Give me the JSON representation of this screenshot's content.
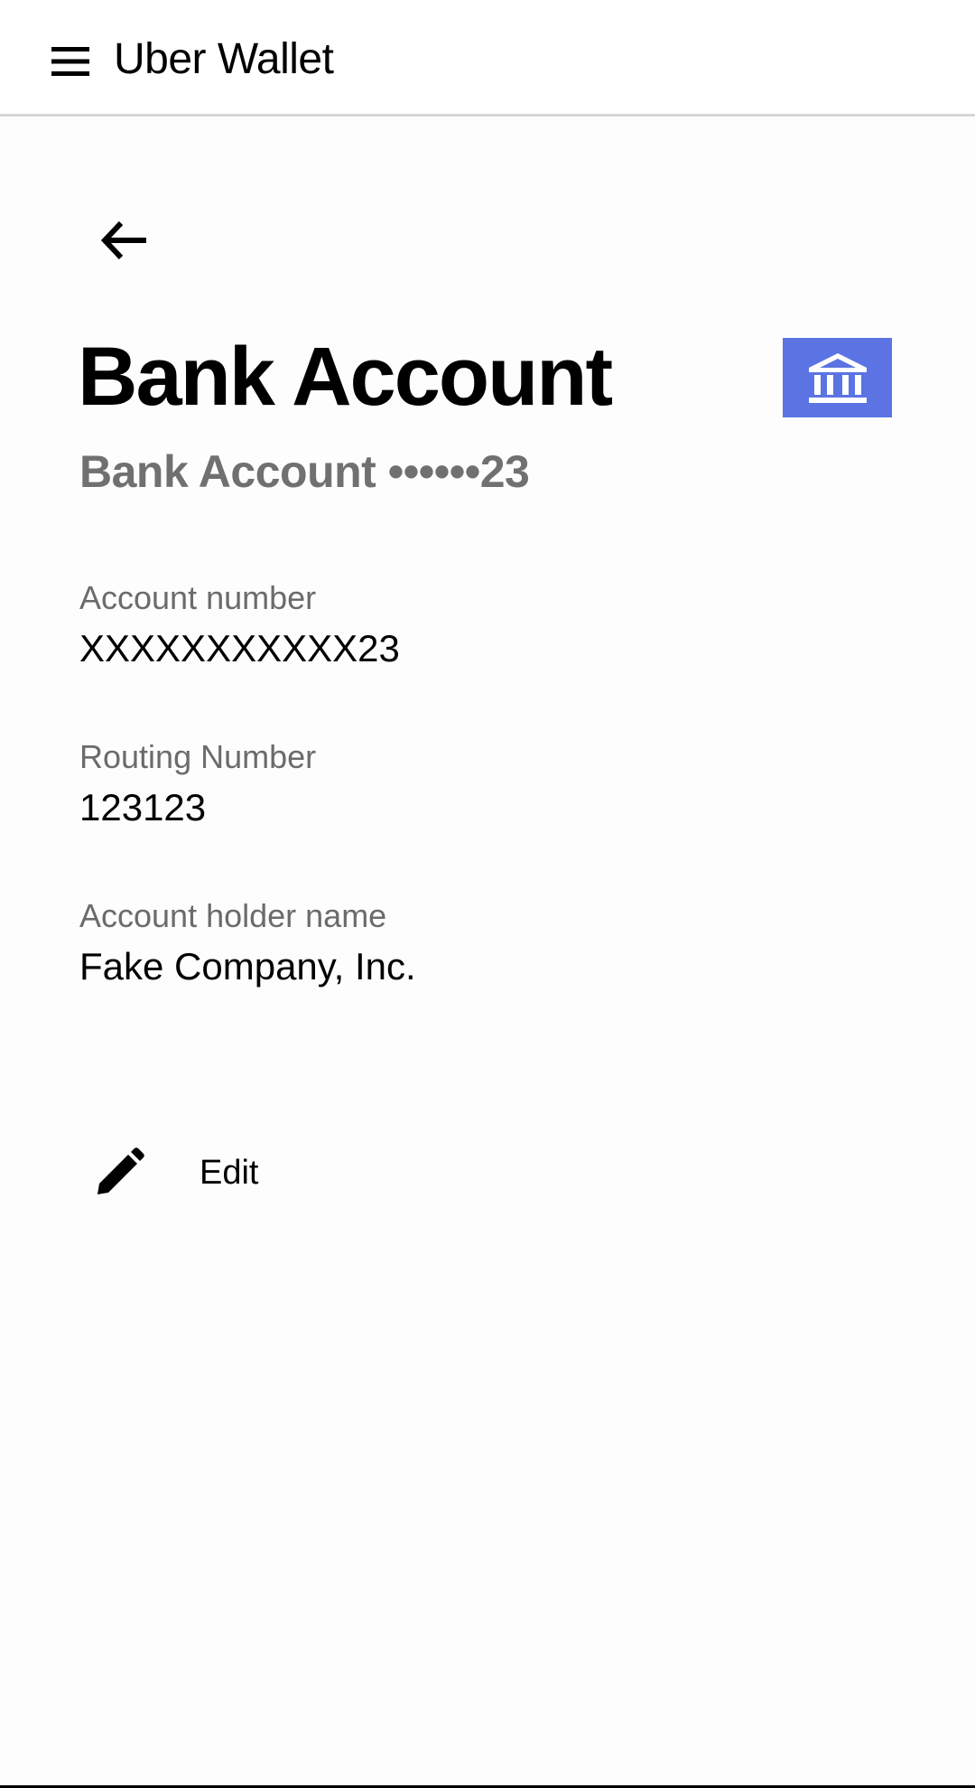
{
  "header": {
    "app_title": "Uber Wallet",
    "menu_icon": "hamburger-menu-icon"
  },
  "main": {
    "back_icon": "arrow-left-icon",
    "title": "Bank Account",
    "subtitle": "Bank Account ••••••23",
    "badge_icon": "bank-icon",
    "badge_color": "#5b73e3",
    "fields": [
      {
        "label": "Account number",
        "value": "XXXXXXXXXXX23"
      },
      {
        "label": "Routing Number",
        "value": "123123"
      },
      {
        "label": "Account holder name",
        "value": "Fake Company, Inc."
      }
    ],
    "edit": {
      "icon": "pencil-icon",
      "label": "Edit"
    }
  }
}
